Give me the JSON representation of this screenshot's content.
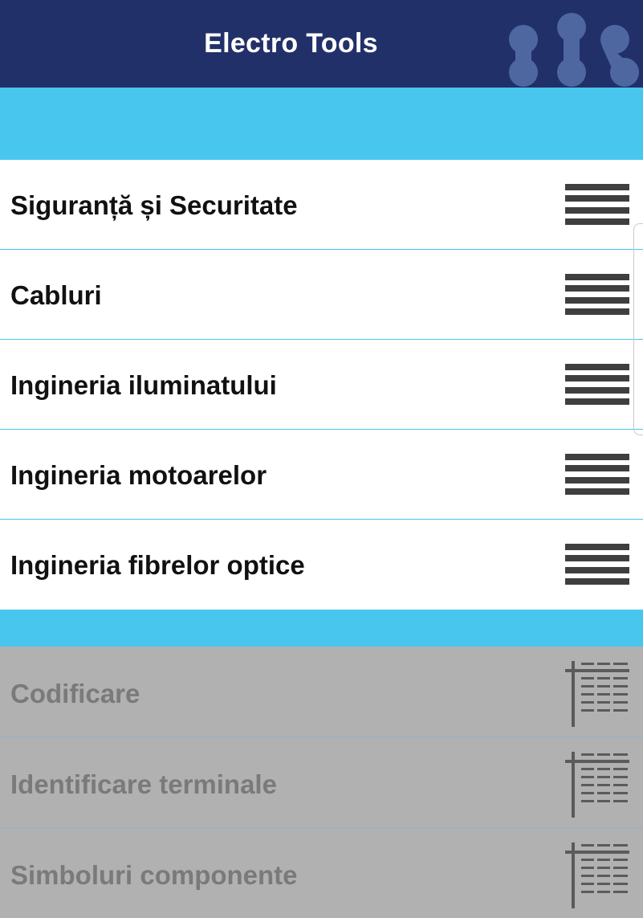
{
  "header": {
    "title": "Electro Tools",
    "logo_icon": "molecule-logo-icon",
    "background_color": "#22306a"
  },
  "accent_color": "#48c6ed",
  "menu": {
    "items": [
      {
        "label": "Siguranță și Securitate",
        "icon": "hamburger-menu-icon"
      },
      {
        "label": "Cabluri",
        "icon": "hamburger-menu-icon"
      },
      {
        "label": "Ingineria iluminatului",
        "icon": "hamburger-menu-icon"
      },
      {
        "label": "Ingineria motoarelor",
        "icon": "hamburger-menu-icon"
      },
      {
        "label": "Ingineria fibrelor optice",
        "icon": "hamburger-menu-icon"
      }
    ]
  },
  "tables": {
    "items": [
      {
        "label": "Codificare",
        "icon": "table-icon"
      },
      {
        "label": "Identificare terminale",
        "icon": "table-icon"
      },
      {
        "label": "Simboluri componente",
        "icon": "table-icon"
      }
    ],
    "disabled": true,
    "background_color": "#b1b1b1"
  }
}
